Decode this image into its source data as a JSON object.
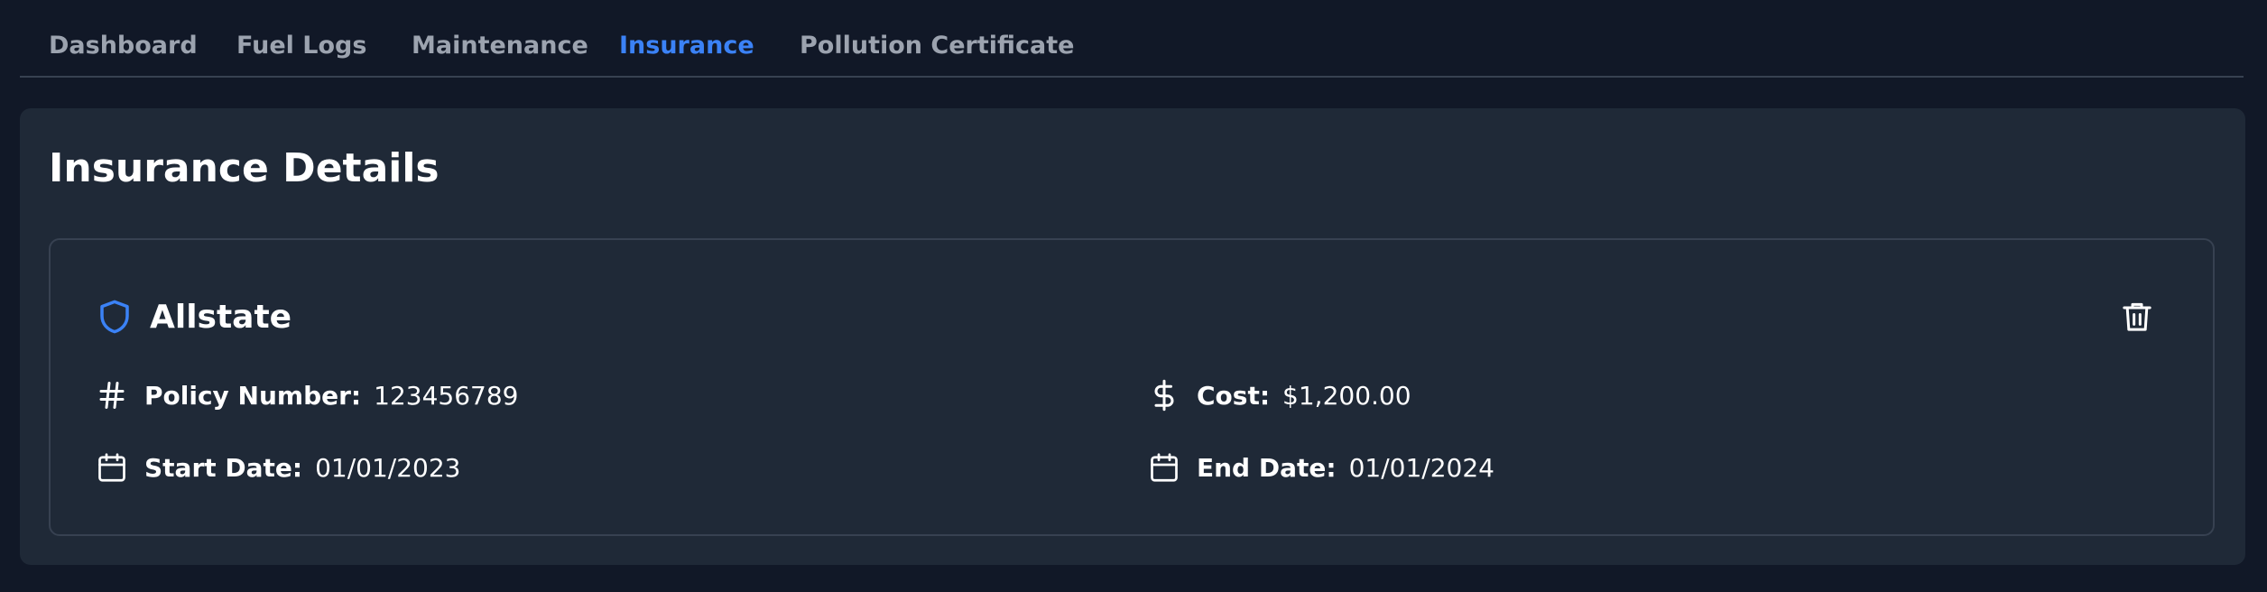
{
  "tabs": [
    {
      "label": "Dashboard",
      "active": false
    },
    {
      "label": "Fuel Logs",
      "active": false
    },
    {
      "label": "Maintenance",
      "active": false
    },
    {
      "label": "Insurance",
      "active": true
    },
    {
      "label": "Pollution Certificate",
      "active": false
    }
  ],
  "panel": {
    "title": "Insurance Details"
  },
  "insurance_card": {
    "provider": "Allstate",
    "provider_icon": "shield-icon",
    "delete_icon": "trash-icon",
    "policy_number": {
      "label": "Policy Number:",
      "value": "123456789",
      "icon": "hash-icon"
    },
    "cost": {
      "label": "Cost:",
      "value": "$1,200.00",
      "icon": "dollar-icon"
    },
    "start_date": {
      "label": "Start Date:",
      "value": "01/01/2023",
      "icon": "calendar-icon"
    },
    "end_date": {
      "label": "End Date:",
      "value": "01/01/2024",
      "icon": "calendar-icon"
    }
  },
  "colors": {
    "background": "#111827",
    "panel": "#1f2937",
    "border": "#374151",
    "accent": "#3b82f6",
    "muted_text": "#9ca3af",
    "text": "#ffffff"
  }
}
